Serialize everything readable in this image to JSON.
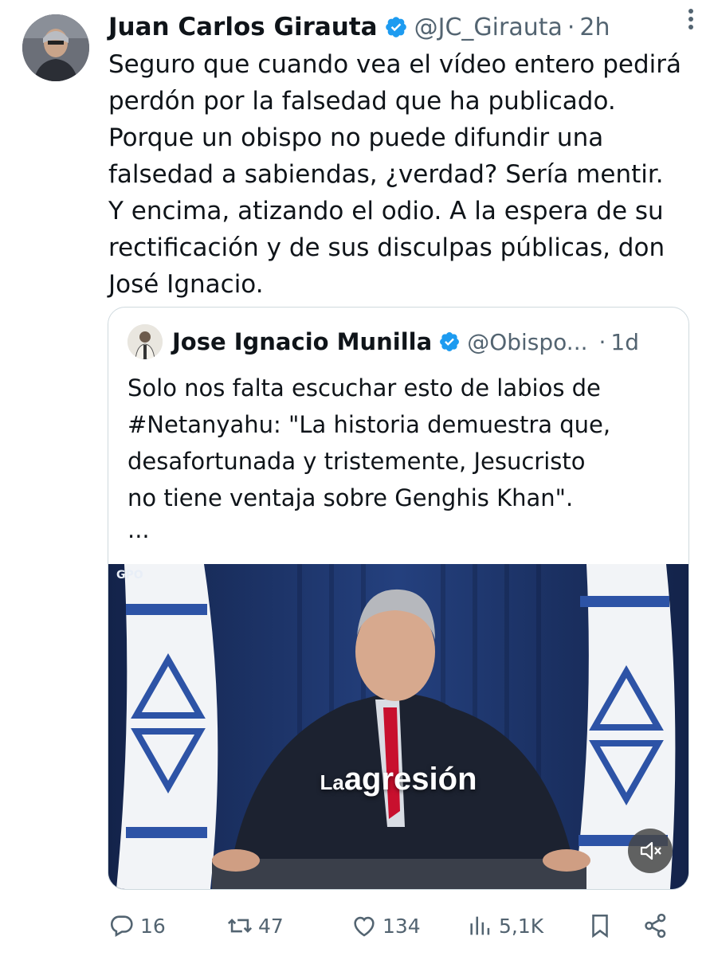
{
  "tweet": {
    "author_name": "Juan Carlos Girauta",
    "handle": "@JC_Girauta",
    "separator": "·",
    "time": "2h",
    "text": "Seguro que cuando vea el vídeo entero pedirá\nperdón por la falsedad que ha publicado.\nPorque un obispo no puede difundir una\nfalsedad a sabiendas, ¿verdad? Sería mentir.\nY encima, atizando el odio. A la espera de su\nrectificación y de sus disculpas públicas, don\nJosé Ignacio."
  },
  "quoted": {
    "author_name": "Jose Ignacio Munilla",
    "handle": "@Obispo...",
    "separator": "·",
    "time": "1d",
    "text": "Solo nos falta escuchar esto de labios de\n#Netanyahu: \"La historia demuestra que,\ndesafortunada y tristemente, Jesucristo\nno tiene ventaja sobre Genghis Khan\".",
    "ellipsis": "...",
    "video": {
      "caption_small": "La",
      "caption_big": "agresión",
      "watermark": "GPO",
      "mute_icon": "speaker-muted-icon"
    }
  },
  "actions": {
    "replies": "16",
    "reposts": "47",
    "likes": "134",
    "views": "5,1K"
  },
  "colors": {
    "text": "#0f1419",
    "secondary": "#536471",
    "verified": "#1d9bf0",
    "border": "#cfd9de"
  },
  "icons": [
    "verified-badge-icon",
    "more-icon",
    "reply-icon",
    "repost-icon",
    "like-icon",
    "views-icon",
    "bookmark-icon",
    "share-icon"
  ]
}
